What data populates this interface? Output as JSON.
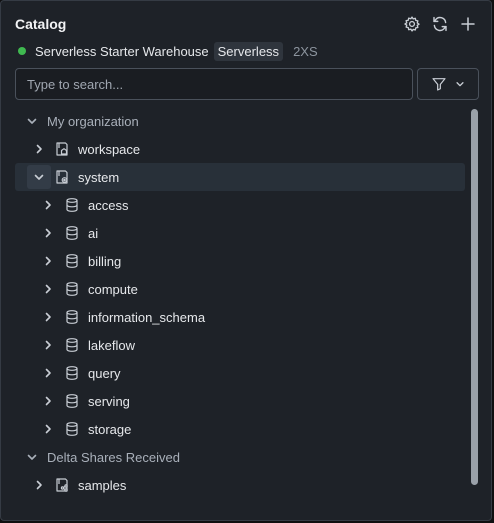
{
  "header": {
    "title": "Catalog",
    "icons": [
      "gear-icon",
      "refresh-icon",
      "plus-icon"
    ]
  },
  "warehouse": {
    "status_color": "#3fb950",
    "name": "Serverless Starter Warehouse",
    "badge": "Serverless",
    "size": "2XS"
  },
  "search": {
    "placeholder": "Type to search...",
    "value": ""
  },
  "filter": {
    "icons": [
      "filter-icon",
      "chevron-down-icon"
    ]
  },
  "tree": {
    "my_org": {
      "label": "My organization",
      "catalogs": {
        "workspace": "workspace",
        "system": "system",
        "schemas": [
          "access",
          "ai",
          "billing",
          "compute",
          "information_schema",
          "lakeflow",
          "query",
          "serving",
          "storage"
        ]
      }
    },
    "delta": {
      "label": "Delta Shares Received",
      "catalogs": {
        "samples": "samples"
      }
    }
  },
  "colors": {
    "panel_bg": "#1e2228",
    "selected_row": "#283039",
    "text": "#e6e8eb",
    "muted": "#a9b0ba"
  }
}
